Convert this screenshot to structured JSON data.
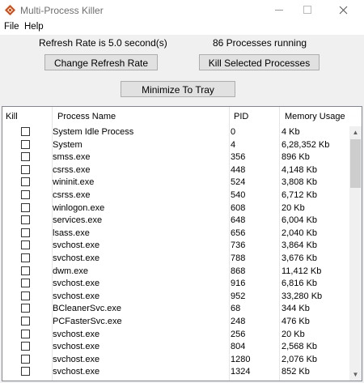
{
  "window": {
    "title": "Multi-Process Killer"
  },
  "menu": {
    "file": "File",
    "help": "Help"
  },
  "status": {
    "refresh": "Refresh Rate is 5.0 second(s)",
    "processes": "86 Processes running"
  },
  "buttons": {
    "change": "Change Refresh Rate",
    "kill": "Kill Selected Processes",
    "minimize": "Minimize To Tray"
  },
  "columns": {
    "kill": "Kill",
    "name": "Process Name",
    "pid": "PID",
    "mem": "Memory Usage"
  },
  "rows": [
    {
      "name": "System Idle Process",
      "pid": "0",
      "mem": "4 Kb"
    },
    {
      "name": "System",
      "pid": "4",
      "mem": "6,28,352 Kb"
    },
    {
      "name": "smss.exe",
      "pid": "356",
      "mem": "896 Kb"
    },
    {
      "name": "csrss.exe",
      "pid": "448",
      "mem": "4,148 Kb"
    },
    {
      "name": "wininit.exe",
      "pid": "524",
      "mem": "3,808 Kb"
    },
    {
      "name": "csrss.exe",
      "pid": "540",
      "mem": "6,712 Kb"
    },
    {
      "name": "winlogon.exe",
      "pid": "608",
      "mem": "20 Kb"
    },
    {
      "name": "services.exe",
      "pid": "648",
      "mem": "6,004 Kb"
    },
    {
      "name": "lsass.exe",
      "pid": "656",
      "mem": "2,040 Kb"
    },
    {
      "name": "svchost.exe",
      "pid": "736",
      "mem": "3,864 Kb"
    },
    {
      "name": "svchost.exe",
      "pid": "788",
      "mem": "3,676 Kb"
    },
    {
      "name": "dwm.exe",
      "pid": "868",
      "mem": "11,412 Kb"
    },
    {
      "name": "svchost.exe",
      "pid": "916",
      "mem": "6,816 Kb"
    },
    {
      "name": "svchost.exe",
      "pid": "952",
      "mem": "33,280 Kb"
    },
    {
      "name": "BCleanerSvc.exe",
      "pid": "68",
      "mem": "344 Kb"
    },
    {
      "name": "PCFasterSvc.exe",
      "pid": "248",
      "mem": "476 Kb"
    },
    {
      "name": "svchost.exe",
      "pid": "256",
      "mem": "20 Kb"
    },
    {
      "name": "svchost.exe",
      "pid": "804",
      "mem": "2,568 Kb"
    },
    {
      "name": "svchost.exe",
      "pid": "1280",
      "mem": "2,076 Kb"
    },
    {
      "name": "svchost.exe",
      "pid": "1324",
      "mem": "852 Kb"
    }
  ]
}
